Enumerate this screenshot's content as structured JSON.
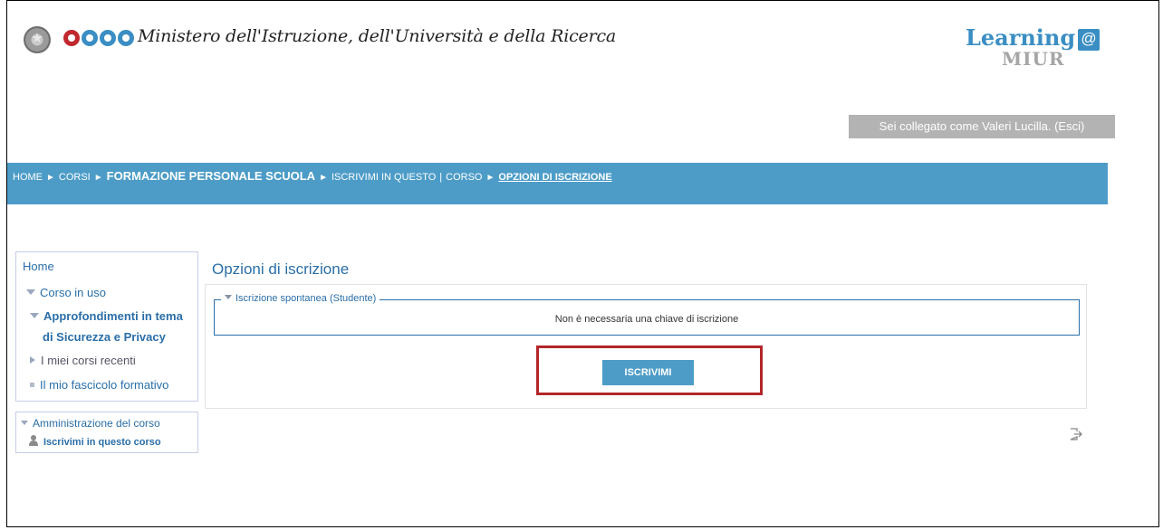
{
  "header": {
    "ministry_title": "Ministero dell'Istruzione, dell'Università e della Ricerca",
    "learning_text": "Learning",
    "learning_at": "@",
    "miur_text": "MIUR",
    "logged_in": "Sei collegato come Valeri Lucilla. (Esci)"
  },
  "breadcrumb": {
    "home": "HOME",
    "corsi": "CORSI",
    "formazione": "FORMAZIONE PERSONALE SCUOLA",
    "iscrivimi": "ISCRIVIMI IN QUESTO",
    "divider": "|",
    "corso": "CORSO",
    "current": "OPZIONI DI ISCRIZIONE",
    "separator": "►"
  },
  "nav": {
    "home": "Home",
    "corso_in_uso": "Corso in uso",
    "course_name_line1": "Approfondimenti in tema",
    "course_name_line2": "di Sicurezza e Privacy",
    "miei_corsi": "I miei corsi recenti",
    "fascicolo": "Il mio fascicolo formativo"
  },
  "admin": {
    "title": "Amministrazione del corso",
    "enrol_link": "Iscrivimi in questo corso"
  },
  "main": {
    "title": "Opzioni di iscrizione",
    "legend": "Iscrizione spontanea (Studente)",
    "no_key": "Non è necessaria una chiave di iscrizione",
    "button": "ISCRIVIMI"
  },
  "colors": {
    "accent": "#4d9cc8",
    "link": "#2a6ea8",
    "highlight": "#b3262a",
    "miur_dots": [
      "#c0282e",
      "#3a8ec3",
      "#3a8ec3",
      "#3a8ec3"
    ]
  },
  "icons": {
    "emblem": "italian-republic-emblem-icon",
    "user": "user-icon",
    "exit": "exit-icon"
  }
}
